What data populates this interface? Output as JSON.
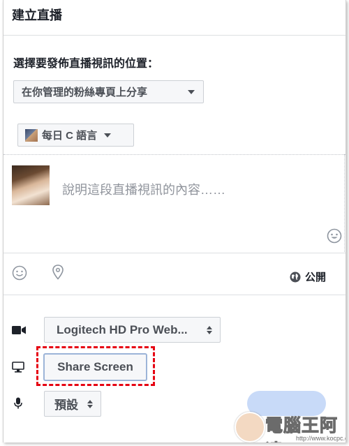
{
  "header": {
    "title": "建立直播"
  },
  "destination": {
    "label": "選擇要發佈直播視訊的位置：",
    "selected": "在你管理的粉絲專頁上分享"
  },
  "page_selector": {
    "name": "每日 C 語言"
  },
  "composer": {
    "placeholder": "說明這段直播視訊的內容……"
  },
  "toolbar": {
    "emoji_icon": "smiley-icon",
    "location_icon": "location-pin-icon",
    "audience": "公開",
    "audience_icon": "globe-icon"
  },
  "sources": {
    "camera": {
      "icon": "video-camera-icon",
      "selected": "Logitech HD Pro Web..."
    },
    "screen": {
      "icon": "monitor-icon",
      "button_label": "Share Screen"
    },
    "microphone": {
      "icon": "microphone-icon",
      "selected": "預設"
    }
  },
  "watermark": {
    "title": "電腦王阿達",
    "url": "http://www.kocpc.com.tw"
  },
  "colors": {
    "highlight": "#e60012",
    "go_live_button": "#c8daf8",
    "text_secondary": "#90949c"
  }
}
